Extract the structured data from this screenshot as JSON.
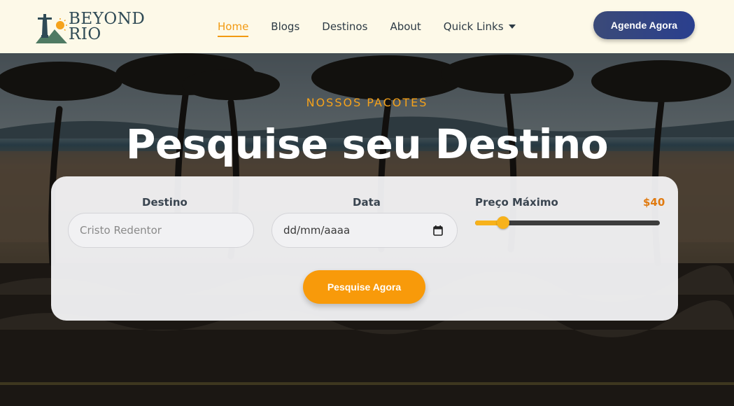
{
  "brand": {
    "line1": "BEYOND",
    "line2": "RIO"
  },
  "nav": {
    "items": [
      {
        "label": "Home",
        "active": true
      },
      {
        "label": "Blogs",
        "active": false
      },
      {
        "label": "Destinos",
        "active": false
      },
      {
        "label": "About",
        "active": false
      },
      {
        "label": "Quick Links",
        "active": false,
        "dropdown": true
      }
    ],
    "cta": "Agende Agora"
  },
  "hero": {
    "eyebrow": "NOSSOS PACOTES",
    "title": "Pesquise seu Destino"
  },
  "search": {
    "destino_label": "Destino",
    "destino_placeholder": "Cristo Redentor",
    "data_label": "Data",
    "data_value": "dd/mm/aaaa",
    "preco_label": "Preço Máximo",
    "preco_value": "$40",
    "slider_fraction": 0.15,
    "button": "Pesquise Agora"
  },
  "colors": {
    "accent": "#f29a12",
    "cta": "#2f418a",
    "price": "#e07a10",
    "nav_bg": "#fdf9e8"
  },
  "icons": [
    "christ-statue-icon",
    "chevron-down-icon",
    "calendar-icon"
  ]
}
